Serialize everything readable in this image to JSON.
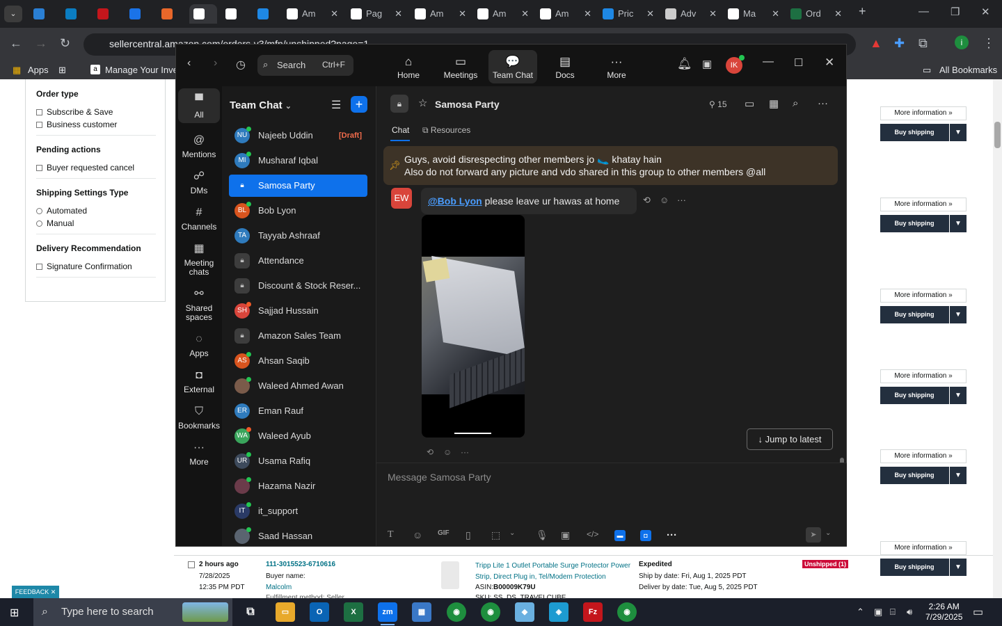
{
  "browser": {
    "tabs": [
      {
        "title": "",
        "color": "#2a7fd4"
      },
      {
        "title": "",
        "color": "#0b7dc1"
      },
      {
        "title": "",
        "color": "#c4161c"
      },
      {
        "title": "",
        "color": "#1a73e8"
      },
      {
        "title": "",
        "color": "#e8672a"
      },
      {
        "title": "",
        "color": "#ffffff"
      },
      {
        "title": "",
        "color": "#ffffff"
      },
      {
        "title": "",
        "color": "#1e88e5"
      },
      {
        "title": "Am",
        "color": "#ffffff"
      },
      {
        "title": "Pag",
        "color": "#ffffff"
      },
      {
        "title": "Am",
        "color": "#ffffff"
      },
      {
        "title": "Am",
        "color": "#ffffff"
      },
      {
        "title": "Am",
        "color": "#ffffff"
      },
      {
        "title": "Pric",
        "color": "#1e88e5"
      },
      {
        "title": "Adv",
        "color": "#cccccc"
      },
      {
        "title": "Ma",
        "color": "#ffffff"
      },
      {
        "title": "Ord",
        "color": "#1d6f42"
      }
    ],
    "url": "sellercentral.amazon.com/orders-v3/mfn/unshipped?page=1",
    "bookmarks": {
      "apps": "Apps",
      "manage": "Manage Your Inven",
      "all": "All Bookmarks"
    }
  },
  "amazon": {
    "filters": [
      {
        "heading": "Order type",
        "options": [
          "Subscribe & Save",
          "Business customer"
        ],
        "kind": "checkbox"
      },
      {
        "heading": "Pending actions",
        "options": [
          "Buyer requested cancel"
        ],
        "kind": "checkbox"
      },
      {
        "heading": "Shipping Settings Type",
        "options": [
          "Automated",
          "Manual"
        ],
        "kind": "radio"
      },
      {
        "heading": "Delivery Recommendation",
        "options": [
          "Signature Confirmation"
        ],
        "kind": "checkbox"
      }
    ],
    "more_info_label": "More information »",
    "buy_shipping_label": "Buy shipping",
    "order": {
      "age": "2 hours ago",
      "date": "7/28/2025",
      "time": "12:35 PM PDT",
      "order_id": "111-3015523-6710616",
      "buyer_label": "Buyer name:",
      "buyer": "Malcolm",
      "fulfillment": "Fulfillment method: Seller",
      "product": "Tripp Lite 1 Outlet Portable Surge Protector Power Strip, Direct Plug in, Tel/Modem Protection",
      "asin_label": "ASIN:",
      "asin": "B00009K79U",
      "sku": "SKU: SS_DS_TRAVELCUBE",
      "shipping": "Expedited",
      "ship_by": "Ship by date: Fri, Aug 1, 2025 PDT",
      "deliver_by": "Deliver by date: Tue, Aug 5, 2025 PDT",
      "status": "Unshipped (1)"
    },
    "feedback": "FEEDBACK ✕"
  },
  "zoom": {
    "search_label": "Search",
    "search_shortcut": "Ctrl+F",
    "nav": [
      {
        "label": "Home",
        "icon": "⌂"
      },
      {
        "label": "Meetings",
        "icon": "▭"
      },
      {
        "label": "Team Chat",
        "icon": "💬"
      },
      {
        "label": "Docs",
        "icon": "▤"
      },
      {
        "label": "More",
        "icon": "···"
      }
    ],
    "avatar": "IK",
    "rail": [
      {
        "label": "All",
        "icon": "▀"
      },
      {
        "label": "Mentions",
        "icon": "@"
      },
      {
        "label": "DMs",
        "icon": "☍"
      },
      {
        "label": "Channels",
        "icon": "#"
      },
      {
        "label": "Meeting chats",
        "icon": "▦"
      },
      {
        "label": "Shared spaces",
        "icon": "⚯"
      },
      {
        "label": "Apps",
        "icon": "◌"
      },
      {
        "label": "External",
        "icon": "◘"
      },
      {
        "label": "Bookmarks",
        "icon": "⛉"
      },
      {
        "label": "More",
        "icon": "···"
      }
    ],
    "list_title": "Team Chat",
    "chats": [
      {
        "name": "Najeeb Uddin",
        "initials": "NU",
        "color": "#2f7bbd",
        "status": "online",
        "badge": "[Draft]"
      },
      {
        "name": "Musharaf Iqbal",
        "initials": "MI",
        "color": "#2f7bbd",
        "status": "online"
      },
      {
        "name": "Samosa Party",
        "lock": true,
        "active": true
      },
      {
        "name": "Bob Lyon",
        "initials": "BL",
        "color": "#d9541e",
        "status": "online"
      },
      {
        "name": "Tayyab Ashraaf",
        "initials": "TA",
        "color": "#2f7bbd",
        "status": "none"
      },
      {
        "name": "Attendance",
        "lock": true
      },
      {
        "name": "Discount & Stock Reser...",
        "lock": true
      },
      {
        "name": "Sajjad Hussain",
        "initials": "SH",
        "color": "#d9453b",
        "status": "busy"
      },
      {
        "name": "Amazon Sales Team",
        "lock": true
      },
      {
        "name": "Ahsan Saqib",
        "initials": "AS",
        "color": "#d9541e",
        "status": "online"
      },
      {
        "name": "Waleed Ahmed Awan",
        "initials": "",
        "color": "#7a5b4a",
        "status": "online"
      },
      {
        "name": "Eman Rauf",
        "initials": "ER",
        "color": "#2f7bbd",
        "status": "none"
      },
      {
        "name": "Waleed Ayub",
        "initials": "WA",
        "color": "#3aa55c",
        "status": "busy"
      },
      {
        "name": "Usama Rafiq",
        "initials": "UR",
        "color": "#3d4a5c",
        "status": "online"
      },
      {
        "name": "Hazama Nazir",
        "initials": "",
        "color": "#6b3b4a",
        "status": "online"
      },
      {
        "name": "it_support",
        "initials": "IT",
        "color": "#2a3a66",
        "status": "online"
      },
      {
        "name": "Saad Hassan",
        "initials": "",
        "color": "#5a6470",
        "status": "online"
      }
    ],
    "channel": {
      "name": "Samosa Party",
      "members": "15",
      "tabs": [
        "Chat",
        "Resources"
      ],
      "pinned_line1": "Guys, avoid disrespecting other members jo 🥿 khatay hain",
      "pinned_line2": "Also do not forward any picture and vdo shared in this group to other members @all",
      "sender_initials": "EW",
      "mention": "@Bob Lyon",
      "message": " please leave ur hawas at home",
      "jump_label": "↓  Jump to latest",
      "composer_placeholder": "Message Samosa Party"
    }
  },
  "taskbar": {
    "search_placeholder": "Type here to search",
    "time": "2:26 AM",
    "date": "7/29/2025"
  }
}
